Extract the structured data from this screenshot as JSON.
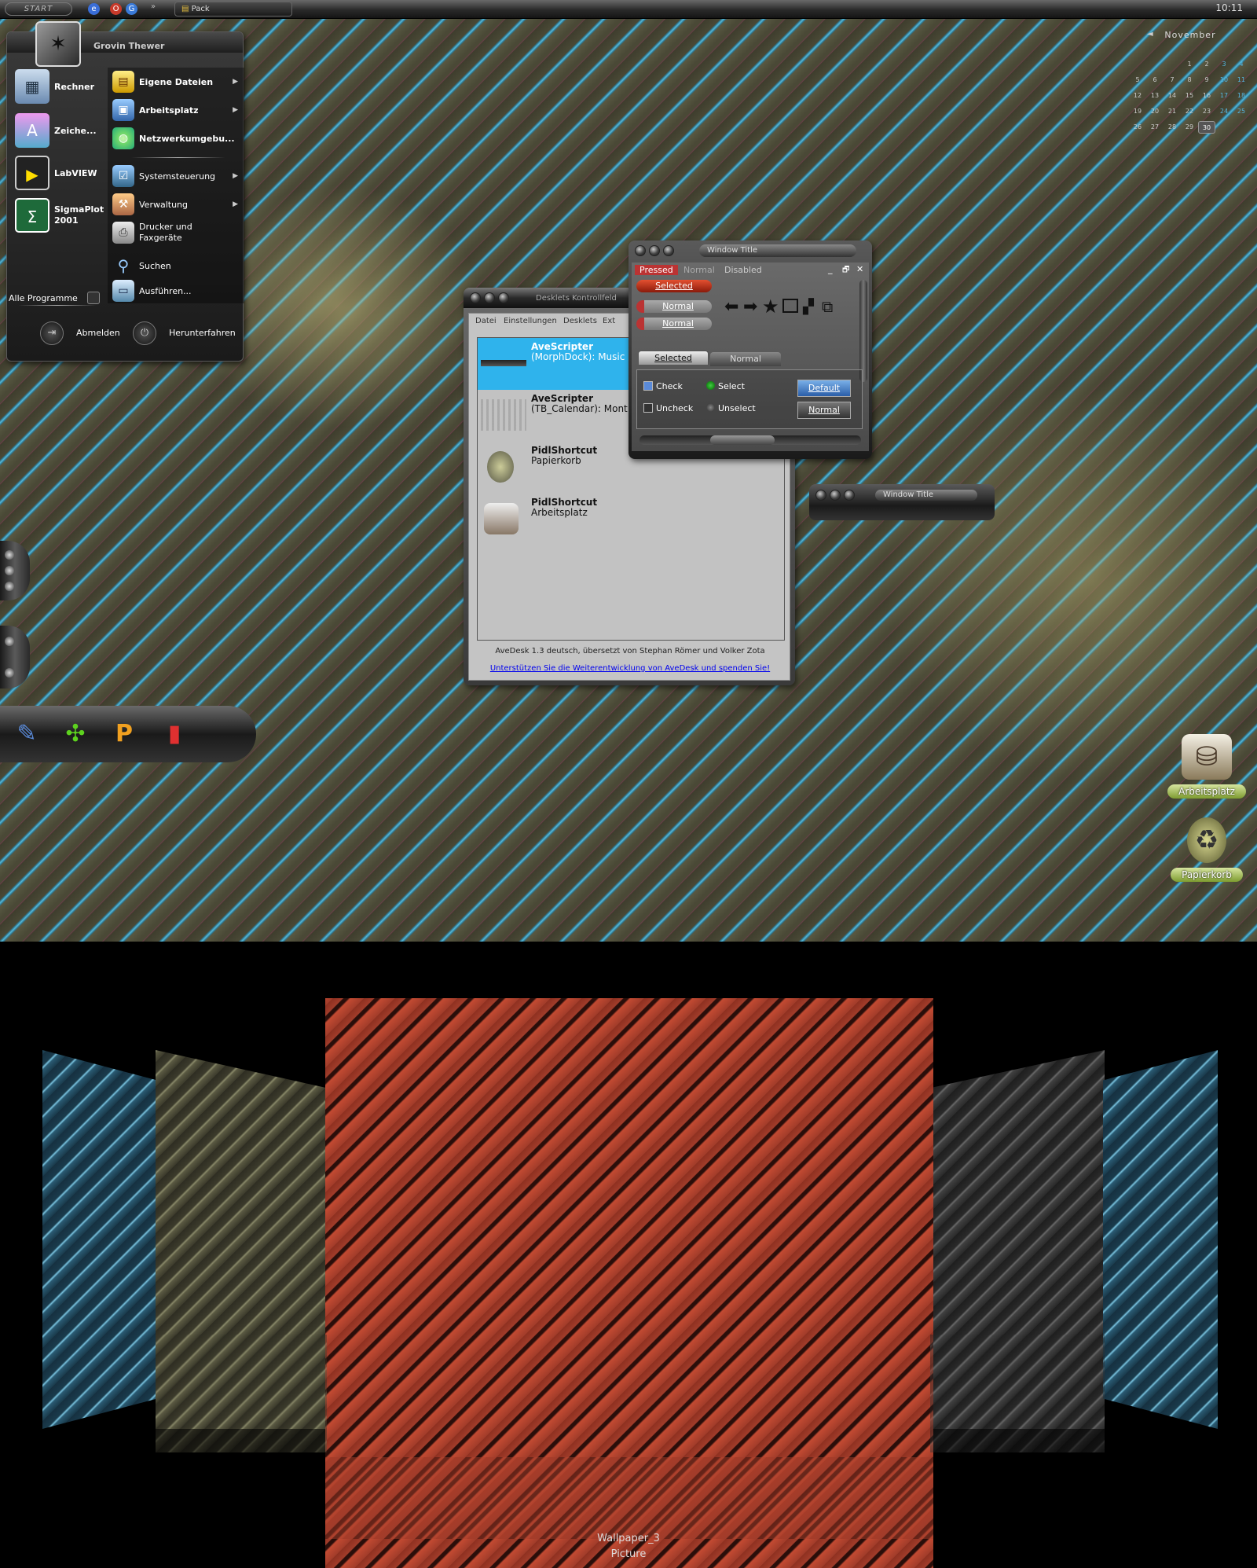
{
  "taskbar": {
    "start_label": "START",
    "overflow": "»",
    "task_label": "Pack",
    "clock": "10:11"
  },
  "startmenu": {
    "user": "Grovin Thewer",
    "pinned": [
      {
        "label": "Rechner",
        "icon": "calculator-icon"
      },
      {
        "label": "Zeiche...",
        "icon": "charmap-icon"
      },
      {
        "label": "LabVIEW",
        "icon": "labview-icon"
      },
      {
        "label": "SigmaPlot 2001",
        "icon": "sigma-icon"
      }
    ],
    "places": [
      {
        "label": "Eigene Dateien",
        "icon": "folder-icon"
      },
      {
        "label": "Arbeitsplatz",
        "icon": "computer-icon"
      },
      {
        "label": "Netzwerkumgebu...",
        "icon": "network-icon"
      }
    ],
    "system": [
      {
        "label": "Systemsteuerung",
        "icon": "control-panel-icon"
      },
      {
        "label": "Verwaltung",
        "icon": "admin-tools-icon"
      },
      {
        "label": "Drucker und Faxgeräte",
        "icon": "printer-icon"
      },
      {
        "label": "Suchen",
        "icon": "search-icon"
      },
      {
        "label": "Ausführen...",
        "icon": "run-icon"
      }
    ],
    "all_programs": "Alle Programme",
    "logoff": "Abmelden",
    "shutdown": "Herunterfahren"
  },
  "calendar": {
    "month": "November",
    "prev": "◄",
    "rows": [
      [
        "",
        "",
        "",
        "1",
        "2",
        "3",
        "4"
      ],
      [
        "5",
        "6",
        "7",
        "8",
        "9",
        "10",
        "11"
      ],
      [
        "12",
        "13",
        "14",
        "15",
        "16",
        "17",
        "18"
      ],
      [
        "19",
        "20",
        "21",
        "22",
        "23",
        "24",
        "25"
      ],
      [
        "26",
        "27",
        "28",
        "29",
        "30",
        "",
        ""
      ]
    ],
    "today": "30"
  },
  "desklets": {
    "title": "Desklets Kontrollfeld",
    "menu": [
      "Datei",
      "Einstellungen",
      "Desklets",
      "Ext"
    ],
    "items": [
      {
        "name": "AveScripter",
        "sub": "(MorphDock): Music"
      },
      {
        "name": "AveScripter",
        "sub": "(TB_Calendar): Mont"
      },
      {
        "name": "PidlShortcut",
        "sub": "Papierkorb"
      },
      {
        "name": "PidlShortcut",
        "sub": "Arbeitsplatz"
      }
    ],
    "footer": "AveDesk 1.3 deutsch, übersetzt von Stephan Römer und Volker Zota",
    "link": "Unterstützen Sie die Weiterentwicklung von AveDesk und spenden Sie!"
  },
  "preview": {
    "title": "Window Title",
    "states": [
      "Pressed",
      "Normal",
      "Disabled"
    ],
    "selected_btn": "Selected",
    "normal_btn1": "Normal",
    "normal_btn2": "Normal",
    "tab_selected": "Selected",
    "tab_normal": "Normal",
    "check": "Check",
    "uncheck": "Uncheck",
    "select": "Select",
    "unselect": "Unselect",
    "default_btn": "Default",
    "normal_btn3": "Normal",
    "window_controls": [
      "_",
      "🗗",
      "✕"
    ]
  },
  "smallwin": {
    "title": "Window Title"
  },
  "desktop_icons": [
    {
      "label": "Arbeitsplatz",
      "icon": "computer-drive-icon"
    },
    {
      "label": "Papierkorb",
      "icon": "recycle-bin-icon"
    }
  ],
  "dock": [
    "recorder-icon",
    "network-tool-icon",
    "powerpoint-icon",
    "spray-can-icon"
  ],
  "showcase": {
    "name": "Wallpaper_3",
    "type": "Picture"
  },
  "colors": {
    "accent_blue": "#55b9d8",
    "selection": "#2fb3ec",
    "red_button": "#e45030",
    "icon_label": "#7e9c30"
  }
}
